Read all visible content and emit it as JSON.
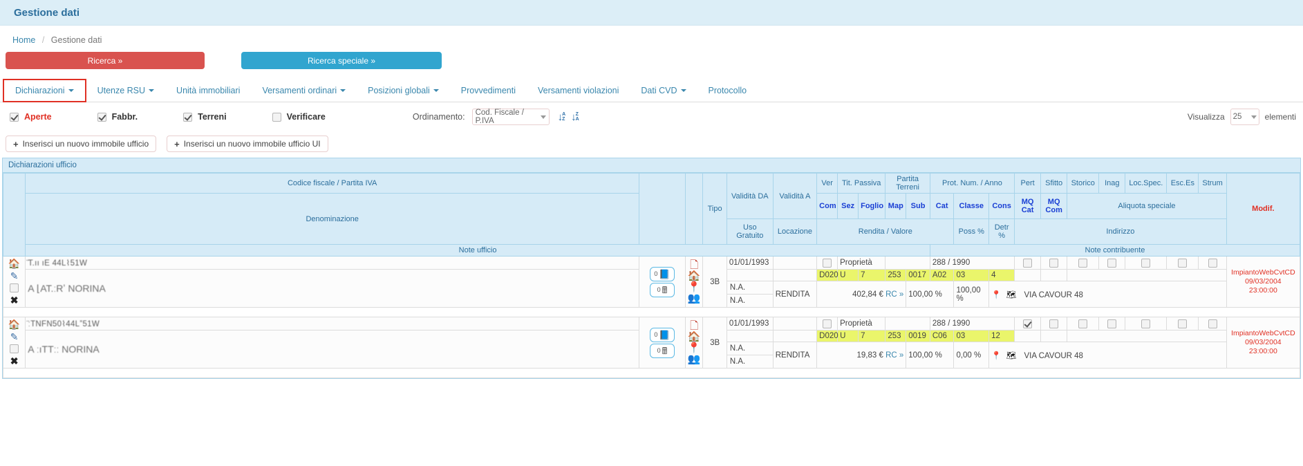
{
  "header": {
    "title": "Gestione dati"
  },
  "breadcrumb": {
    "home": "Home",
    "sep": "/",
    "current": "Gestione dati"
  },
  "search": {
    "primary_label": "Ricerca »",
    "special_label": "Ricerca speciale »",
    "primary_color": "#d9534f",
    "special_color": "#31a5cf"
  },
  "tabs": [
    {
      "label": "Dichiarazioni",
      "caret": true,
      "active": true
    },
    {
      "label": "Utenze RSU",
      "caret": true,
      "active": false
    },
    {
      "label": "Unità immobiliari",
      "caret": false,
      "active": false
    },
    {
      "label": "Versamenti ordinari",
      "caret": true,
      "active": false
    },
    {
      "label": "Posizioni globali",
      "caret": true,
      "active": false
    },
    {
      "label": "Provvedimenti",
      "caret": false,
      "active": false
    },
    {
      "label": "Versamenti violazioni",
      "caret": false,
      "active": false
    },
    {
      "label": "Dati CVD",
      "caret": true,
      "active": false
    },
    {
      "label": "Protocollo",
      "caret": false,
      "active": false
    }
  ],
  "filters": {
    "checks": [
      {
        "label": "Aperte",
        "checked": true,
        "style": "red"
      },
      {
        "label": "Fabbr.",
        "checked": true,
        "style": "dark"
      },
      {
        "label": "Terreni",
        "checked": true,
        "style": "dark"
      },
      {
        "label": "Verificare",
        "checked": false,
        "style": "dark"
      }
    ],
    "ordinamento_label": "Ordinamento:",
    "ordinamento_value": "Cod. Fiscale / P.IVA",
    "sort_asc_icon": "sort-alpha-asc-icon",
    "sort_desc_icon": "sort-alpha-desc-icon",
    "visualizza_label": "Visualizza",
    "visualizza_value": "25",
    "elementi_label": "elementi"
  },
  "actions": {
    "insert_office": "Inserisci un nuovo immobile ufficio",
    "insert_office_ui": "Inserisci un nuovo immobile ufficio UI",
    "plus": "+"
  },
  "panel": {
    "title": "Dichiarazioni ufficio"
  },
  "grid_headers": {
    "codice_fiscale": "Codice fiscale / Partita IVA",
    "denominazione": "Denominazione",
    "note_ufficio": "Note ufficio",
    "note_contribuente": "Note contribuente",
    "tipo": "Tipo",
    "validita_da": "Validità DA",
    "validita_a": "Validità A",
    "ver": "Ver",
    "tit_passiva": "Tit. Passiva",
    "partita_terreni": "Partita Terreni",
    "prot_num_anno": "Prot. Num. / Anno",
    "pert": "Pert",
    "sfitto": "Sfitto",
    "storico": "Storico",
    "inag": "Inag",
    "loc_spec": "Loc.Spec.",
    "esc_es": "Esc.Es",
    "strum": "Strum",
    "modif": "Modif.",
    "com": "Com",
    "sez": "Sez",
    "foglio": "Foglio",
    "map": "Map",
    "sub": "Sub",
    "cat": "Cat",
    "classe": "Classe",
    "cons": "Cons",
    "mq_cat": "MQ Cat",
    "mq_com": "MQ Com",
    "aliquota_speciale": "Aliquota speciale",
    "uso_gratuito": "Uso Gratuito",
    "locazione": "Locazione",
    "rendita_valore": "Rendita / Valore",
    "poss_pct": "Poss %",
    "detr_pct": "Detr %",
    "indirizzo": "Indirizzo"
  },
  "rows": [
    {
      "codice_fiscale": "̈̈T.ıı ıE  44L⌇51W",
      "denominazione": "A ⌊AT.ːRʼ NORINA",
      "badge_book_count": "0",
      "badge_calc_count": "0",
      "tipo": "3B",
      "validita_da": "01/01/1993",
      "validita_a": "",
      "ver_checked": false,
      "tit_passiva": "Proprietà",
      "prot_num_anno": "288 / 1990",
      "com": "D020",
      "sez": "U",
      "foglio": "7",
      "map": "253",
      "sub": "0017",
      "cat": "A02",
      "classe": "03",
      "cons": "4",
      "mq_cat": "",
      "mq_com": "",
      "uso_gratuito": "N.A.",
      "locazione": "N.A.",
      "rendita_label": "RENDITA",
      "rendita_value": "402,84 €",
      "rc_link": "RC »",
      "poss_pct": "100,00 %",
      "detr_pct": "100,00 %",
      "indirizzo": "VIA CAVOUR 48",
      "flags": {
        "pert": false,
        "sfitto": false,
        "storico": false,
        "inag": false,
        "loc_spec": false,
        "esc_es": false,
        "strum": false
      },
      "modif_source": "ImpiantoWebCvtCD",
      "modif_date": "09/03/2004",
      "modif_time": "23:00:00"
    },
    {
      "codice_fiscale": "̈ːTNFN50⌇44Lˮ51W",
      "denominazione": "A ːıTTːː NORINA",
      "badge_book_count": "0",
      "badge_calc_count": "0",
      "tipo": "3B",
      "validita_da": "01/01/1993",
      "validita_a": "",
      "ver_checked": false,
      "tit_passiva": "Proprietà",
      "prot_num_anno": "288 / 1990",
      "com": "D020",
      "sez": "U",
      "foglio": "7",
      "map": "253",
      "sub": "0019",
      "cat": "C06",
      "classe": "03",
      "cons": "12",
      "mq_cat": "",
      "mq_com": "",
      "uso_gratuito": "N.A.",
      "locazione": "N.A.",
      "rendita_label": "RENDITA",
      "rendita_value": "19,83 €",
      "rc_link": "RC »",
      "poss_pct": "100,00 %",
      "detr_pct": "0,00 %",
      "indirizzo": "VIA CAVOUR 48",
      "flags": {
        "pert": true,
        "sfitto": false,
        "storico": false,
        "inag": false,
        "loc_spec": false,
        "esc_es": false,
        "strum": false
      },
      "modif_source": "ImpiantoWebCvtCD",
      "modif_date": "09/03/2004",
      "modif_time": "23:00:00"
    }
  ],
  "icons": {
    "home": "home-icon",
    "pencil": "pencil-edit-icon",
    "checkbox": "row-select-checkbox",
    "close": "delete-x-icon",
    "book": "book-icon",
    "calculator": "calculator-icon",
    "pdf": "pdf-file-icon",
    "house": "building-icon",
    "pin": "map-pin-icon",
    "people": "people-group-icon",
    "person": "person-location-icon"
  }
}
